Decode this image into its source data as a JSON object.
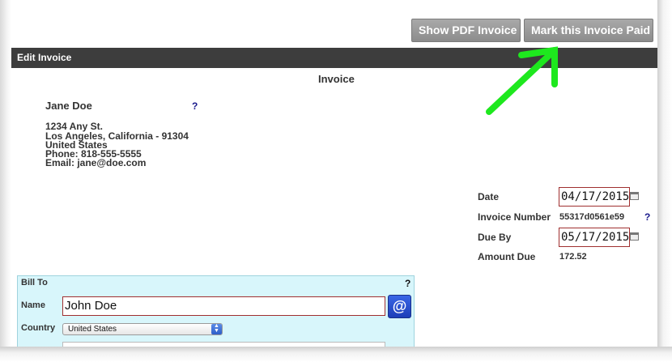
{
  "toolbar": {
    "show_pdf_label": "Show PDF Invoice",
    "mark_paid_label": "Mark this Invoice Paid"
  },
  "section": {
    "title": "Edit Invoice"
  },
  "invoice": {
    "heading": "Invoice",
    "from": {
      "name": "Jane Doe",
      "help": "?",
      "address_line1": "1234 Any St.",
      "address_line2": "Los Angeles, California - 91304",
      "country": "United States",
      "phone": "Phone: 818-555-5555",
      "email": "Email: jane@doe.com"
    },
    "meta": {
      "date_label": "Date",
      "date_value": "04/17/2015",
      "number_label": "Invoice Number",
      "number_value": "55317d0561e59",
      "number_help": "?",
      "due_label": "Due By",
      "due_value": "05/17/2015",
      "amount_label": "Amount Due",
      "amount_value": "172.52"
    }
  },
  "bill_to": {
    "title": "Bill To",
    "help": "?",
    "name_label": "Name",
    "name_value": "John Doe",
    "email_button": "@",
    "country_label": "Country",
    "country_value": "United States"
  },
  "annotation": {
    "arrow_color": "#1ee81e"
  }
}
